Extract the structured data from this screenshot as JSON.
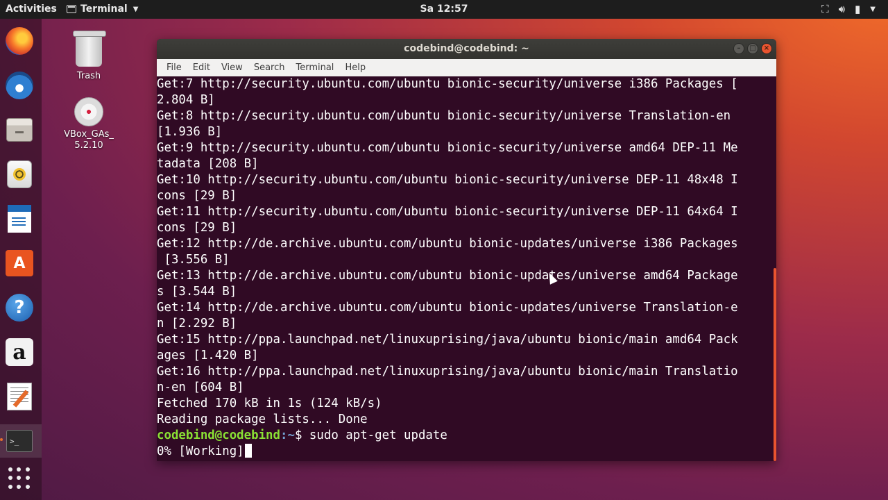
{
  "top_panel": {
    "activities": "Activities",
    "app_name": "Terminal",
    "clock": "Sa 12:57"
  },
  "dock": {
    "items": [
      "firefox",
      "thunderbird",
      "files",
      "rhythmbox",
      "libreoffice-writer",
      "ubuntu-software",
      "help",
      "amazon",
      "text-editor",
      "terminal",
      "show-applications"
    ]
  },
  "desktop": {
    "trash_label": "Trash",
    "vbox_label": "VBox_GAs_\n5.2.10"
  },
  "window": {
    "title": "codebind@codebind: ~",
    "menu": [
      "File",
      "Edit",
      "View",
      "Search",
      "Terminal",
      "Help"
    ]
  },
  "terminal": {
    "lines": [
      "Get:7 http://security.ubuntu.com/ubuntu bionic-security/universe i386 Packages [",
      "2.804 B]",
      "Get:8 http://security.ubuntu.com/ubuntu bionic-security/universe Translation-en",
      "[1.936 B]",
      "Get:9 http://security.ubuntu.com/ubuntu bionic-security/universe amd64 DEP-11 Me",
      "tadata [208 B]",
      "Get:10 http://security.ubuntu.com/ubuntu bionic-security/universe DEP-11 48x48 I",
      "cons [29 B]",
      "Get:11 http://security.ubuntu.com/ubuntu bionic-security/universe DEP-11 64x64 I",
      "cons [29 B]",
      "Get:12 http://de.archive.ubuntu.com/ubuntu bionic-updates/universe i386 Packages",
      " [3.556 B]",
      "Get:13 http://de.archive.ubuntu.com/ubuntu bionic-updates/universe amd64 Package",
      "s [3.544 B]",
      "Get:14 http://de.archive.ubuntu.com/ubuntu bionic-updates/universe Translation-e",
      "n [2.292 B]",
      "Get:15 http://ppa.launchpad.net/linuxuprising/java/ubuntu bionic/main amd64 Pack",
      "ages [1.420 B]",
      "Get:16 http://ppa.launchpad.net/linuxuprising/java/ubuntu bionic/main Translatio",
      "n-en [604 B]",
      "Fetched 170 kB in 1s (124 kB/s)",
      "Reading package lists... Done"
    ],
    "prompt_user": "codebind@codebind",
    "prompt_path": ":~",
    "prompt_symbol": "$ ",
    "command": "sudo apt-get update",
    "status_line": "0% [Working]"
  }
}
